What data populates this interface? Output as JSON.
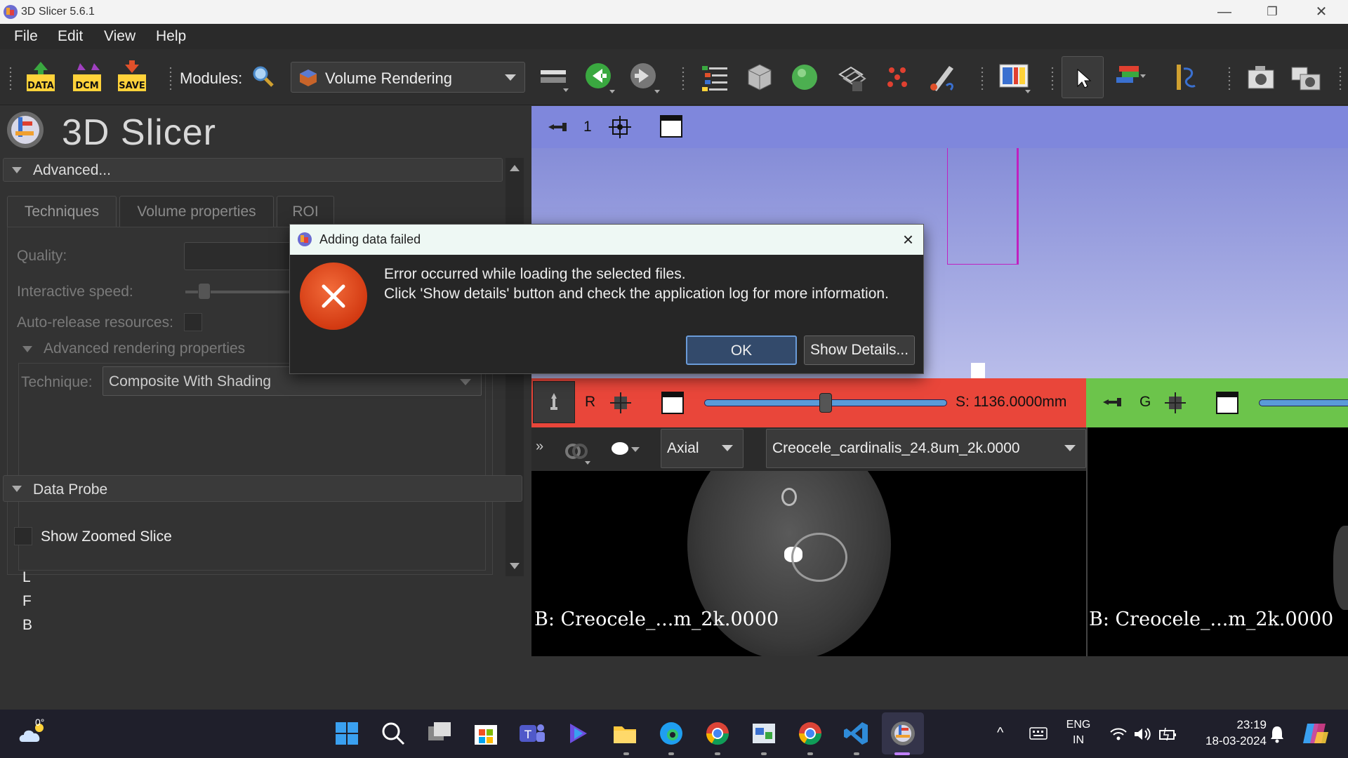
{
  "window": {
    "title": "3D Slicer 5.6.1"
  },
  "menu": [
    "File",
    "Edit",
    "View",
    "Help"
  ],
  "toolbar": {
    "modules_label": "Modules:",
    "module_selected": "Volume Rendering",
    "data_label": "DATA",
    "dcm_label": "DCM",
    "save_label": "SAVE"
  },
  "left_panel": {
    "logo_text": "3D Slicer",
    "advanced_header": "Advanced...",
    "tabs": [
      "Techniques",
      "Volume properties",
      "ROI"
    ],
    "quality_label": "Quality:",
    "interactive_speed_label": "Interactive speed:",
    "interactive_speed_level": 0.12,
    "auto_release_label": "Auto-release resources:",
    "advanced_rendering_label": "Advanced rendering properties",
    "technique_label": "Technique:",
    "technique_value": "Composite With Shading",
    "data_probe_header": "Data Probe",
    "show_zoomed_label": "Show Zoomed Slice",
    "probe_rows": [
      "L",
      "F",
      "B"
    ]
  },
  "view3d": {
    "view_number": "1"
  },
  "red_slice": {
    "letter": "R",
    "offset": "S: 1136.0000mm",
    "slider_level": 0.5,
    "orientation": "Axial",
    "volume": "Creocele_cardinalis_24.8um_2k.0000",
    "overlay": "B: Creocele_...m_2k.0000"
  },
  "green_slice": {
    "letter": "G",
    "overlay": "B: Creocele_...m_2k.0000"
  },
  "dialog": {
    "title": "Adding data failed",
    "line1": "Error occurred while loading the selected files.",
    "line2": "Click 'Show details' button and check the application log for more information.",
    "ok": "OK",
    "details": "Show Details..."
  },
  "taskbar": {
    "temperature": "0°",
    "lang1": "ENG",
    "lang2": "IN",
    "time": "23:19",
    "date": "18-03-2024"
  },
  "colors": {
    "red_view": "#e9463a",
    "green_view": "#6cc44b",
    "view3d_bar": "#7f87dc",
    "error": "#d33a12"
  }
}
